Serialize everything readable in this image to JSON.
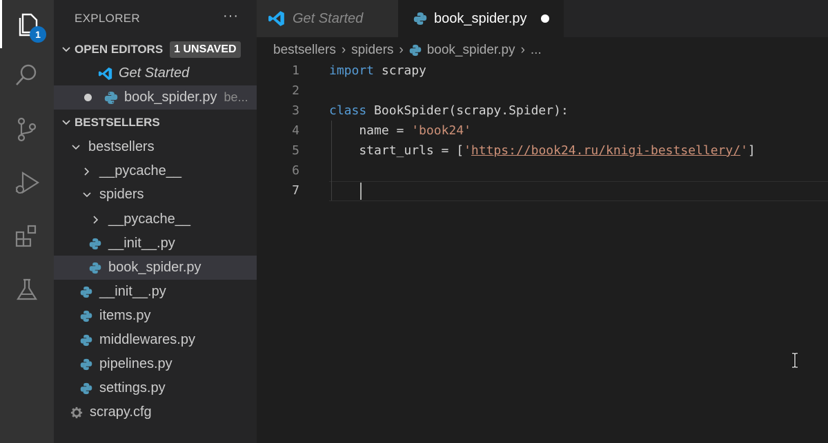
{
  "colors": {
    "accent": "#0e70c0",
    "python_icon": "#519aba",
    "vscode_icon": "#23a9f2",
    "keyword": "#569cd6",
    "string": "#ce9178"
  },
  "activity_bar": {
    "items": [
      {
        "icon": "files-icon",
        "badge": "1",
        "active": true
      },
      {
        "icon": "search-icon"
      },
      {
        "icon": "source-control-icon"
      },
      {
        "icon": "run-debug-icon"
      },
      {
        "icon": "extensions-icon"
      },
      {
        "icon": "testing-flask-icon"
      }
    ]
  },
  "sidebar": {
    "title": "EXPLORER",
    "more": "···",
    "open_editors": {
      "label": "OPEN EDITORS",
      "badge": "1 UNSAVED",
      "items": [
        {
          "label": "Get Started",
          "icon": "vscode-icon"
        },
        {
          "label": "book_spider.py",
          "desc": "be...",
          "icon": "python-icon",
          "unsaved": true
        }
      ]
    },
    "workspace": {
      "label": "BESTSELLERS",
      "tree": [
        {
          "label": "bestsellers",
          "type": "folder-open"
        },
        {
          "label": "__pycache__",
          "type": "folder-closed"
        },
        {
          "label": "spiders",
          "type": "folder-open"
        },
        {
          "label": "__pycache__",
          "type": "folder-closed"
        },
        {
          "label": "__init__.py",
          "type": "python"
        },
        {
          "label": "book_spider.py",
          "type": "python",
          "selected": true
        },
        {
          "label": "__init__.py",
          "type": "python"
        },
        {
          "label": "items.py",
          "type": "python"
        },
        {
          "label": "middlewares.py",
          "type": "python"
        },
        {
          "label": "pipelines.py",
          "type": "python"
        },
        {
          "label": "settings.py",
          "type": "python"
        },
        {
          "label": "scrapy.cfg",
          "type": "config"
        }
      ]
    }
  },
  "tabs": [
    {
      "label": "Get Started",
      "icon": "vscode-icon",
      "active": false
    },
    {
      "label": "book_spider.py",
      "icon": "python-icon",
      "active": true,
      "unsaved": true
    }
  ],
  "breadcrumb": {
    "items": [
      "bestsellers",
      "spiders",
      "book_spider.py",
      "..."
    ]
  },
  "editor": {
    "current_line": 7,
    "lines": [
      {
        "num": "1",
        "import_kw": "import",
        "rest": " scrapy"
      },
      {
        "num": "2"
      },
      {
        "num": "3",
        "class_kw": "class",
        "rest": " BookSpider(scrapy.Spider):"
      },
      {
        "num": "4",
        "prefix": "    name = ",
        "string": "'book24'"
      },
      {
        "num": "5",
        "prefix": "    start_urls = [",
        "quote_open": "'",
        "url": "https://book24.ru/knigi-bestsellery/",
        "quote_close": "'",
        "suffix": "]"
      },
      {
        "num": "6"
      },
      {
        "num": "7"
      }
    ]
  }
}
